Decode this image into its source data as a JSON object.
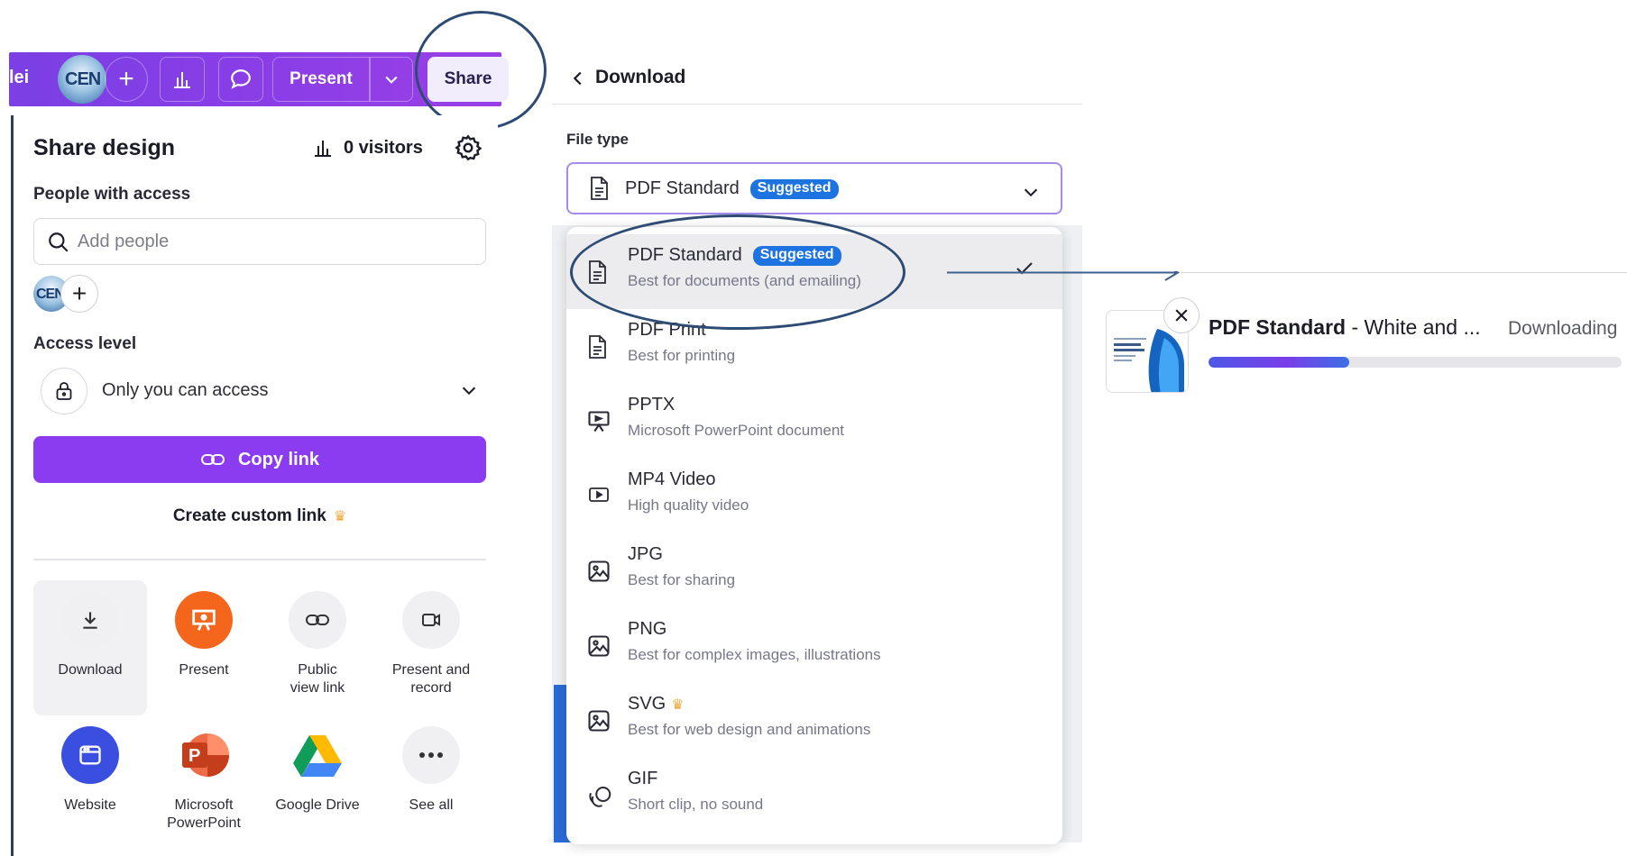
{
  "toolbar": {
    "left_text": "lei",
    "avatar_text": "CEN",
    "present_label": "Present",
    "share_label": "Share"
  },
  "share_panel": {
    "title": "Share design",
    "visitors": "0 visitors",
    "people_label": "People with access",
    "search_placeholder": "Add people",
    "avatar_text": "CEN",
    "access_label": "Access level",
    "access_value": "Only you can access",
    "copy_link": "Copy link",
    "custom_link": "Create custom link",
    "tiles": [
      {
        "label": "Download",
        "icon": "download-icon"
      },
      {
        "label": "Present",
        "icon": "present-icon"
      },
      {
        "label": "Public view link",
        "icon": "link-icon"
      },
      {
        "label": "Present and record",
        "icon": "camera-icon"
      },
      {
        "label": "Website",
        "icon": "website-icon"
      },
      {
        "label": "Microsoft PowerPoint",
        "icon": "powerpoint-icon"
      },
      {
        "label": "Google Drive",
        "icon": "google-drive-icon"
      },
      {
        "label": "See all",
        "icon": "more-icon"
      }
    ]
  },
  "download_panel": {
    "title": "Download",
    "file_type_label": "File type",
    "selected": "PDF Standard",
    "badge": "Suggested",
    "options": [
      {
        "name": "PDF Standard",
        "desc": "Best for documents (and emailing)",
        "icon": "document-icon"
      },
      {
        "name": "PDF Print",
        "desc": "Best for printing",
        "icon": "document-icon"
      },
      {
        "name": "PPTX",
        "desc": "Microsoft PowerPoint document",
        "icon": "presentation-icon"
      },
      {
        "name": "MP4 Video",
        "desc": "High quality video",
        "icon": "video-icon"
      },
      {
        "name": "JPG",
        "desc": "Best for sharing",
        "icon": "image-icon"
      },
      {
        "name": "PNG",
        "desc": "Best for complex images, illustrations",
        "icon": "image-icon"
      },
      {
        "name": "SVG",
        "desc": "Best for web design and animations",
        "icon": "image-icon"
      },
      {
        "name": "GIF",
        "desc": "Short clip, no sound",
        "icon": "gif-icon"
      }
    ]
  },
  "downloading": {
    "name_bold": "PDF Standard",
    "name_rest": " - White and ...",
    "status": "Downloading",
    "progress": 0.34
  },
  "colors": {
    "accent": "#8b3cf0",
    "badge": "#1d74e0",
    "annotation": "#2e4c73"
  }
}
